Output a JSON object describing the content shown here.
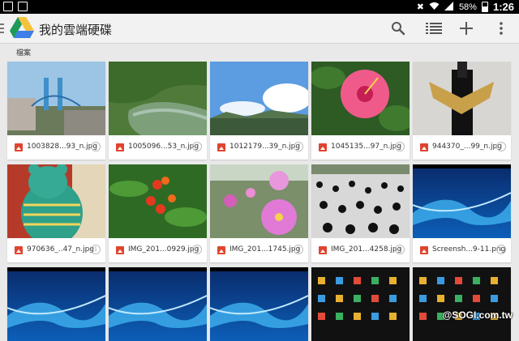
{
  "status_bar": {
    "battery": "58%",
    "time": "1:26"
  },
  "action_bar": {
    "title": "我的雲端硬碟",
    "icons": [
      "search-icon",
      "list-view-icon",
      "add-icon",
      "overflow-menu-icon"
    ]
  },
  "breadcrumb": "檔案",
  "files": [
    {
      "name": "1003828...93_n.jpg",
      "thumb": "bridge"
    },
    {
      "name": "1005096...53_n.jpg",
      "thumb": "river"
    },
    {
      "name": "1012179...39_n.jpg",
      "thumb": "sky"
    },
    {
      "name": "1045135...97_n.jpg",
      "thumb": "hibiscus"
    },
    {
      "name": "944370_...99_n.jpg",
      "thumb": "costume"
    },
    {
      "name": "970636_..47_n.jpg",
      "thumb": "bear"
    },
    {
      "name": "IMG_201...0929.jpg",
      "thumb": "flower-red"
    },
    {
      "name": "IMG_201...1745.jpg",
      "thumb": "cosmos"
    },
    {
      "name": "IMG_201...4258.jpg",
      "thumb": "pandas"
    },
    {
      "name": "Screensh...9-11.png",
      "thumb": "screen-blue"
    },
    {
      "name": "",
      "thumb": "screen-blue"
    },
    {
      "name": "",
      "thumb": "screen-blue"
    },
    {
      "name": "",
      "thumb": "screen-blue"
    },
    {
      "name": "",
      "thumb": "screen-dark"
    },
    {
      "name": "",
      "thumb": "screen-dark"
    }
  ],
  "watermark": "@SOGI.com.tw"
}
